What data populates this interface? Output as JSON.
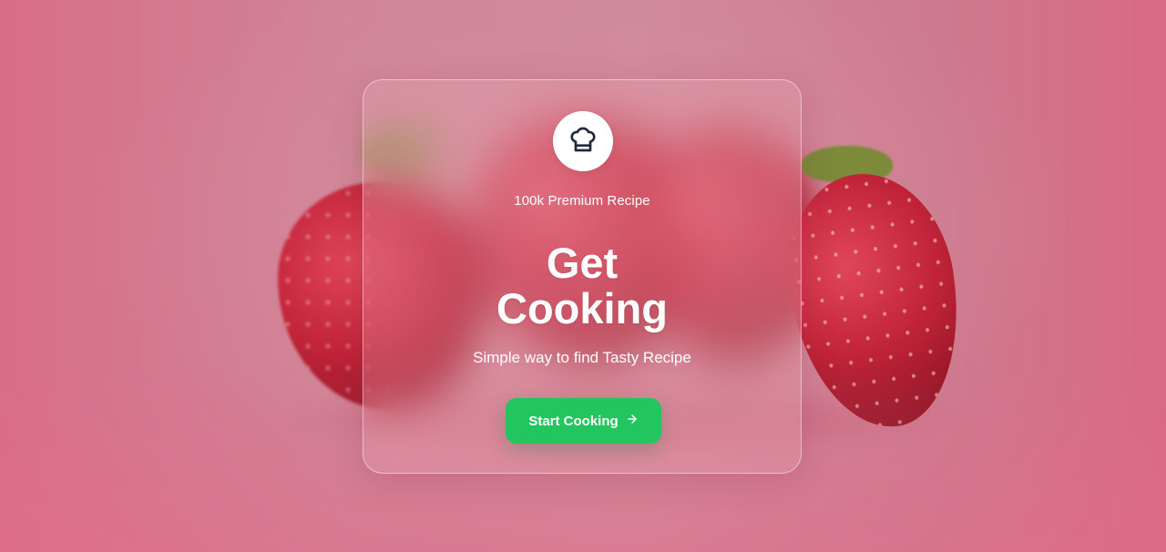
{
  "hero": {
    "tagline": "100k Premium Recipe",
    "headline_line1": "Get",
    "headline_line2": "Cooking",
    "subtitle": "Simple way to find Tasty Recipe",
    "cta_label": "Start Cooking",
    "logo_icon": "chef-hat-icon",
    "cta_icon": "arrow-right-icon"
  },
  "colors": {
    "accent": "#22c55e",
    "background": "#c97385",
    "text": "#ffffff",
    "icon": "#1e2a3b"
  }
}
